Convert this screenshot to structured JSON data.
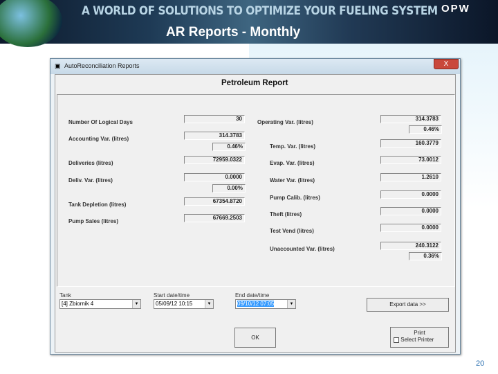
{
  "banner": {
    "slogan": "A WORLD OF SOLUTIONS TO OPTIMIZE YOUR FUELING SYSTEM",
    "title": "AR Reports - Monthly",
    "logo": "OPW"
  },
  "window": {
    "title": "AutoReconciliation Reports",
    "close": "X",
    "report_title": "Petroleum Report"
  },
  "left": [
    {
      "label": "Number Of Logical Days",
      "value": "30"
    },
    {
      "label": "Accounting Var. (litres)",
      "value": "314.3783",
      "pct": "0.46%"
    },
    {
      "label": "Deliveries (litres)",
      "value": "72959.0322"
    },
    {
      "label": "Deliv. Var. (litres)",
      "value": "0.0000",
      "pct": "0.00%"
    },
    {
      "label": "Tank Depletion (litres)",
      "value": "67354.8720"
    },
    {
      "label": "Pump Sales (litres)",
      "value": "67669.2503"
    }
  ],
  "right": [
    {
      "label": "Operating Var. (litres)",
      "value": "314.3783",
      "pct": "0.46%"
    },
    {
      "label": "Temp. Var. (litres)",
      "value": "160.3779"
    },
    {
      "label": "Evap. Var. (litres)",
      "value": "73.0012"
    },
    {
      "label": "Water Var. (litres)",
      "value": "1.2610"
    },
    {
      "label": "Pump Calib. (litres)",
      "value": "0.0000"
    },
    {
      "label": "Theft (litres)",
      "value": "0.0000"
    },
    {
      "label": "Test Vend (litres)",
      "value": "0.0000"
    },
    {
      "label": "Unaccounted Var. (litres)",
      "value": "240.3122",
      "pct": "0.36%"
    }
  ],
  "controls": {
    "tank_label": "Tank",
    "tank_value": "[4] Zbiornik 4",
    "start_label": "Start date/time",
    "start_value": "05/09/12 10:15",
    "end_label": "End date/time",
    "end_value": "09/10/12 07:05",
    "export": "Export data >>",
    "ok": "OK",
    "print": "Print",
    "select_printer": "Select Printer"
  },
  "page_number": "20"
}
